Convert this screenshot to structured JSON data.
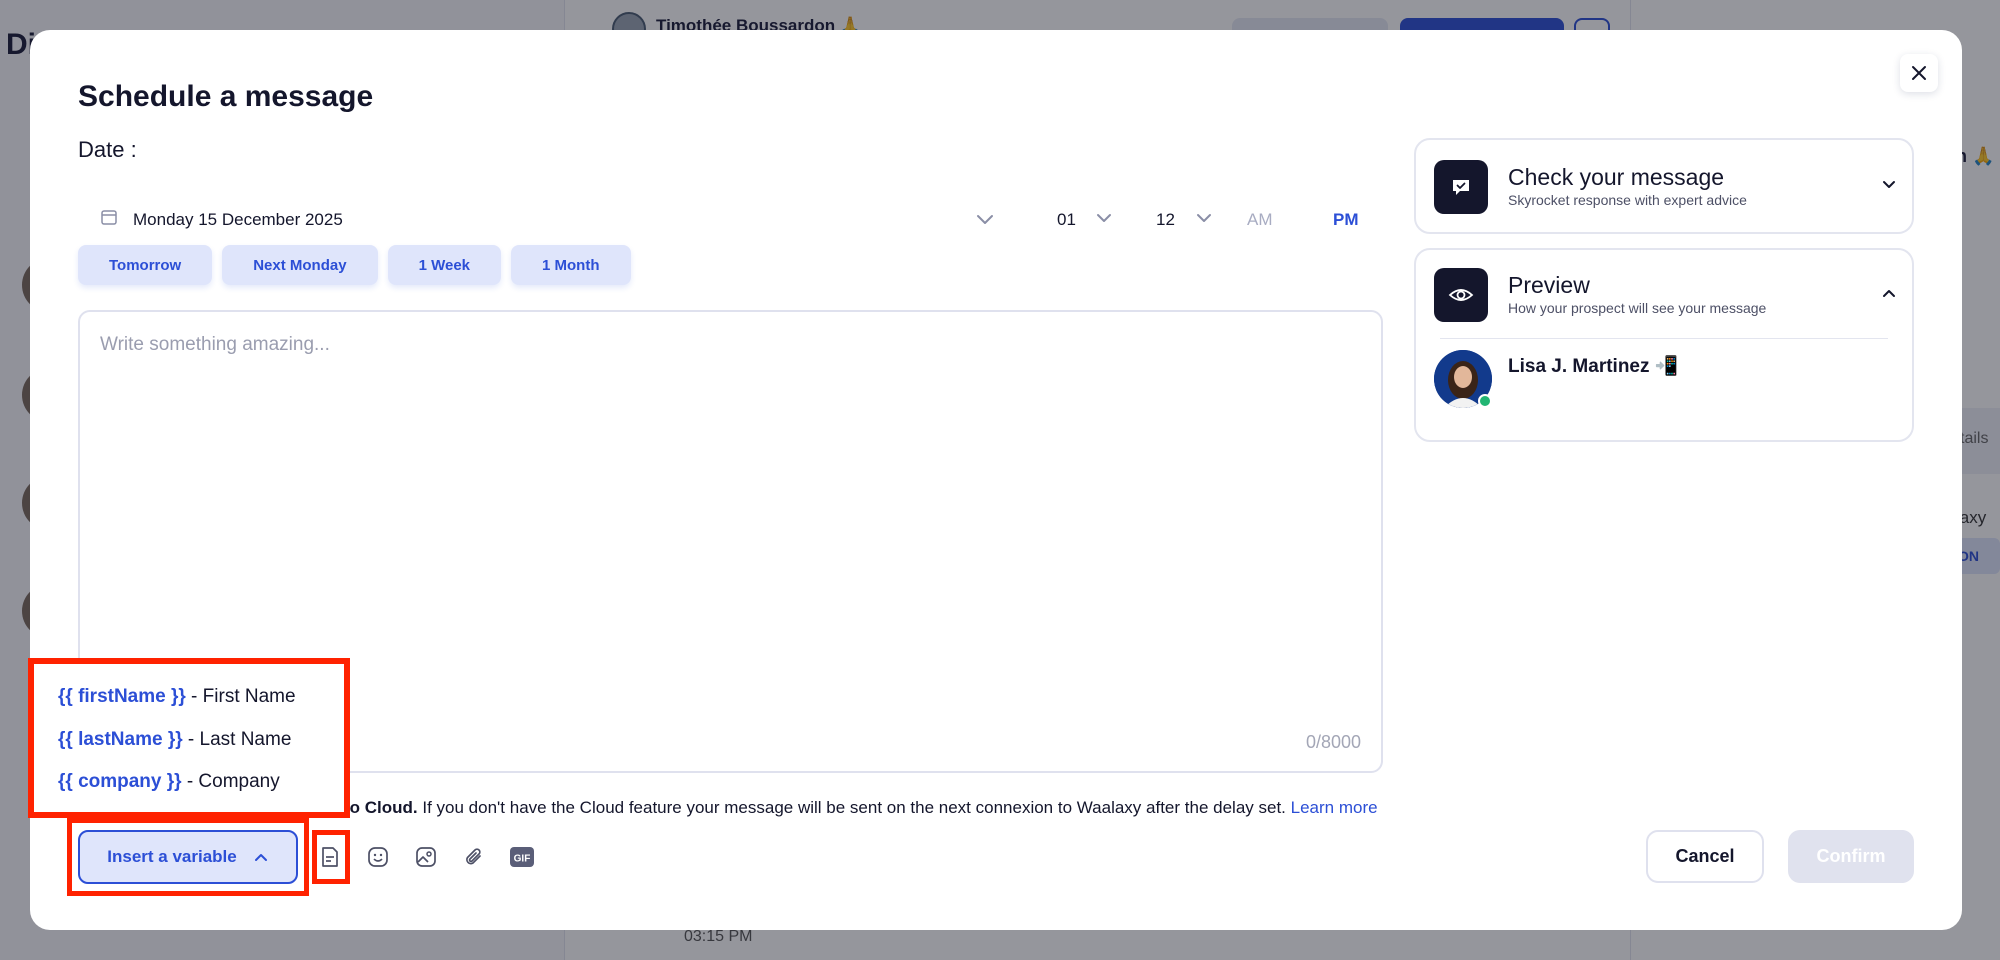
{
  "background": {
    "left_title": "Di",
    "contact_name": "Timothée Boussardon 🙏",
    "time": "03:15 PM",
    "right_name": "n 🙏",
    "details_label": "tails",
    "waalaxy_label": "laxy",
    "badge_label": "ON"
  },
  "modal": {
    "title": "Schedule a message",
    "date_label": "Date :",
    "date_value": "Monday 15 December 2025",
    "hour": "01",
    "minute": "12",
    "am_label": "AM",
    "pm_label": "PM",
    "quick_dates": [
      "Tomorrow",
      "Next Monday",
      "1 Week",
      "1 Month"
    ],
    "editor_placeholder": "Write something amazing...",
    "char_counter": "0/8000",
    "cloud_note_bold": "to Cloud.",
    "cloud_note_text": " If you don't have the Cloud feature your message will be sent on the next connexion to Waalaxy after the delay set. ",
    "learn_more": "Learn more",
    "insert_variable_label": "Insert a variable",
    "variables": [
      {
        "code": "{{ firstName }}",
        "label": " - First Name"
      },
      {
        "code": "{{ lastName }}",
        "label": " - Last Name"
      },
      {
        "code": "{{ company }}",
        "label": " - Company"
      }
    ],
    "cancel_label": "Cancel",
    "confirm_label": "Confirm"
  },
  "check_card": {
    "title": "Check your message",
    "subtitle": "Skyrocket response with expert advice"
  },
  "preview_card": {
    "title": "Preview",
    "subtitle": "How your prospect will see your message",
    "prospect_name": "Lisa J. Martinez 📲"
  },
  "colors": {
    "accent": "#2c4fd6",
    "highlight_box": "#ff2200",
    "online_status": "#22b573"
  },
  "icons": [
    "calendar-icon",
    "chevron-down-icon",
    "close-icon",
    "chevron-up-icon",
    "template-icon",
    "emoji-icon",
    "image-icon",
    "attachment-icon",
    "gif-icon",
    "message-check-icon",
    "eye-icon"
  ]
}
